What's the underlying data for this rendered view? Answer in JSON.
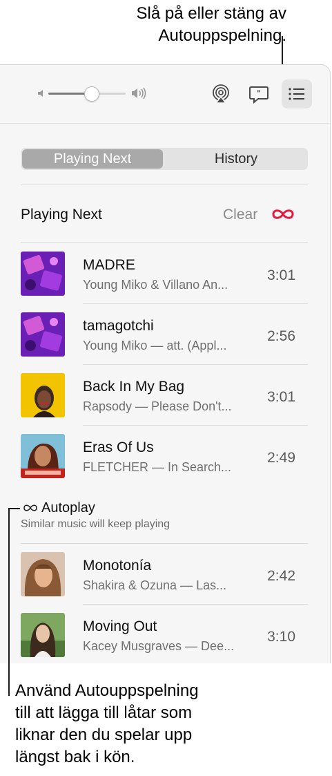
{
  "callouts": {
    "top_line1": "Slå på eller stäng av",
    "top_line2": "Autouppspelning.",
    "bottom_line1": "Använd Autouppspelning",
    "bottom_line2": "till att lägga till låtar som",
    "bottom_line3": "liknar den du spelar upp",
    "bottom_line4": "längst bak i kön."
  },
  "toolbar": {
    "volume_level": 0.55,
    "icons": [
      "volume-low-icon",
      "volume-high-icon",
      "airplay-icon",
      "lyrics-icon",
      "queue-list-icon"
    ]
  },
  "tabs": {
    "playing_next": "Playing Next",
    "history": "History"
  },
  "queue": {
    "heading": "Playing Next",
    "clear_label": "Clear",
    "autoplay_icon": "infinity-icon",
    "autoplay_color": "#e8173d",
    "songs": [
      {
        "title": "MADRE",
        "subtitle": "Young Miko & Villano An...",
        "duration": "3:01"
      },
      {
        "title": "tamagotchi",
        "subtitle": "Young Miko — att. (Appl...",
        "duration": "2:56"
      },
      {
        "title": "Back In My Bag",
        "subtitle": "Rapsody — Please Don't...",
        "duration": "3:01"
      },
      {
        "title": "Eras Of Us",
        "subtitle": "FLETCHER — In Search...",
        "duration": "2:49"
      }
    ]
  },
  "autoplay": {
    "title": "Autoplay",
    "subtitle": "Similar music will keep playing",
    "songs": [
      {
        "title": "Monotonía",
        "subtitle": "Shakira & Ozuna — Las...",
        "duration": "2:42"
      },
      {
        "title": "Moving Out",
        "subtitle": "Kacey Musgraves — Dee...",
        "duration": "3:10"
      }
    ]
  }
}
